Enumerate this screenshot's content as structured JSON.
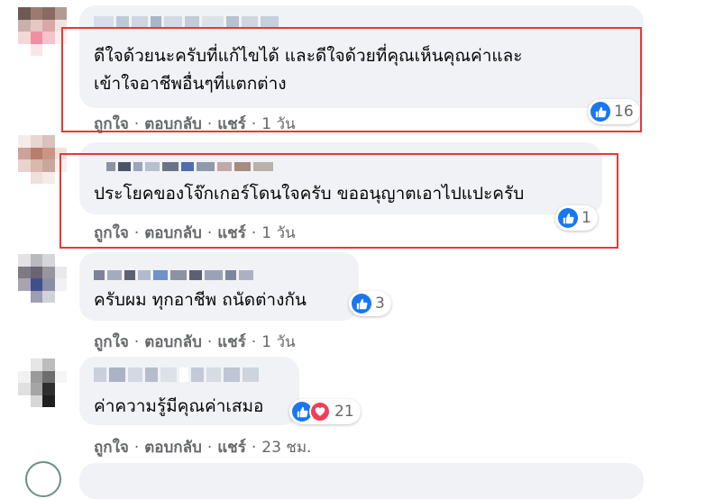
{
  "comments": [
    {
      "text_lines": [
        "ดีใจด้วยนะครับที่แก้ไขได้ และดีใจด้วยที่คุณเห็นคุณค่าและ",
        "เข้าใจอาชีพอื่นๆที่แตกต่าง"
      ],
      "reaction_count": "16",
      "reactions": [
        "like"
      ],
      "actions": {
        "like": "ถูกใจ",
        "reply": "ตอบกลับ",
        "share": "แชร์",
        "time": "1 วัน"
      },
      "highlighted": true
    },
    {
      "text_lines": [
        "ประโยคของโจ๊กเกอร์โดนใจครับ ขออนุญาตเอาไปแปะครับ"
      ],
      "reaction_count": "1",
      "reactions": [
        "like"
      ],
      "actions": {
        "like": "ถูกใจ",
        "reply": "ตอบกลับ",
        "share": "แชร์",
        "time": "1 วัน"
      },
      "highlighted": true
    },
    {
      "text_lines": [
        "ครับผม ทุกอาชีพ ถนัดต่างกัน"
      ],
      "reaction_count": "3",
      "reactions": [
        "like"
      ],
      "actions": {
        "like": "ถูกใจ",
        "reply": "ตอบกลับ",
        "share": "แชร์",
        "time": "1 วัน"
      },
      "highlighted": false
    },
    {
      "text_lines": [
        "ค่าความรู้มีคุณค่าเสมอ"
      ],
      "reaction_count": "21",
      "reactions": [
        "like",
        "love"
      ],
      "actions": {
        "like": "ถูกใจ",
        "reply": "ตอบกลับ",
        "share": "แชร์",
        "time": "23 ชม."
      },
      "highlighted": false
    }
  ],
  "separator": "·",
  "colors": {
    "bubble": "#f0f2f5",
    "highlight_border": "#e53935",
    "like_blue": "#1877f2",
    "love_red": "#f33e58",
    "meta_gray": "#65676b"
  },
  "icons": {
    "like": "thumbs-up-icon",
    "love": "heart-icon"
  }
}
